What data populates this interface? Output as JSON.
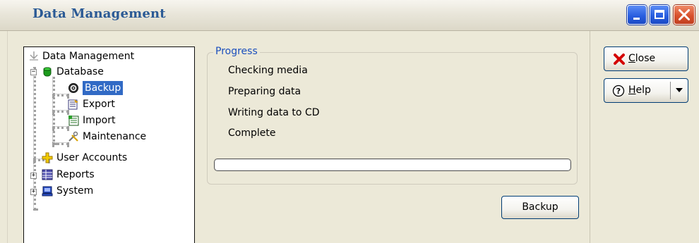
{
  "window": {
    "title": "Data Management"
  },
  "tree": {
    "items": [
      {
        "label": "Data Management",
        "icon": "data-management-icon",
        "level": 0
      },
      {
        "label": "Database",
        "icon": "database-icon",
        "level": 1,
        "expanded": true
      },
      {
        "label": "Backup",
        "icon": "backup-icon",
        "level": 2,
        "selected": true
      },
      {
        "label": "Export",
        "icon": "export-icon",
        "level": 2
      },
      {
        "label": "Import",
        "icon": "import-icon",
        "level": 2
      },
      {
        "label": "Maintenance",
        "icon": "maintenance-icon",
        "level": 2
      },
      {
        "label": "User Accounts",
        "icon": "user-accounts-icon",
        "level": 1
      },
      {
        "label": "Reports",
        "icon": "reports-icon",
        "level": 1,
        "expanded": false
      },
      {
        "label": "System",
        "icon": "system-icon",
        "level": 1,
        "expanded": false
      }
    ]
  },
  "progress": {
    "legend": "Progress",
    "steps": [
      "Checking media",
      "Preparing data",
      "Writing data to CD",
      "Complete"
    ],
    "value": 0
  },
  "buttons": {
    "backup": "Backup",
    "close_mnemonic": "C",
    "close_rest": "lose",
    "help_mnemonic": "H",
    "help_rest": "elp"
  },
  "colors": {
    "title": "#2b5a95",
    "selection": "#316ac5",
    "legend": "#1b4fbd",
    "close_icon": "#d40000"
  }
}
